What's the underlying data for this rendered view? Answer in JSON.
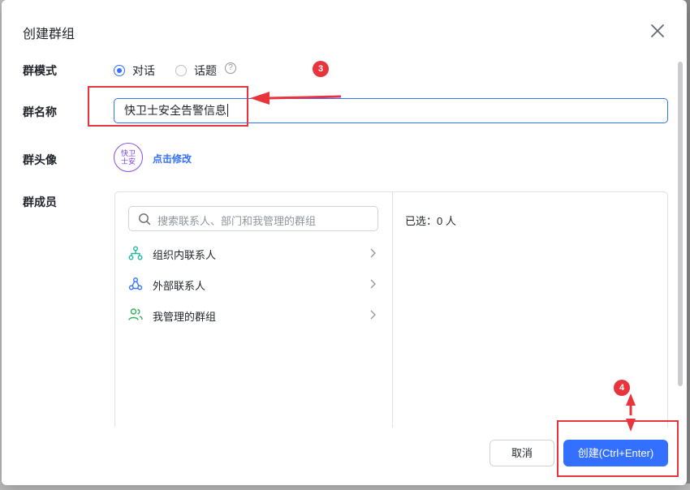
{
  "dialog": {
    "title": "创建群组"
  },
  "form": {
    "mode_label": "群模式",
    "mode_options": [
      "对话",
      "话题"
    ],
    "mode_selected": "对话",
    "mode_help": "?",
    "name_label": "群名称",
    "name_value": "快卫士安全告警信息",
    "avatar_label": "群头像",
    "avatar_text_line1": "快卫",
    "avatar_text_line2": "士安",
    "avatar_edit": "点击修改",
    "members_label": "群成员"
  },
  "members": {
    "search_placeholder": "搜索联系人、部门和我管理的群组",
    "items": [
      {
        "label": "组织内联系人",
        "icon": "org-tree-icon"
      },
      {
        "label": "外部联系人",
        "icon": "external-contacts-icon"
      },
      {
        "label": "我管理的群组",
        "icon": "managed-groups-icon"
      }
    ],
    "selected_text": "已选：0 人"
  },
  "footer": {
    "cancel_label": "取消",
    "create_label": "创建(Ctrl+Enter)"
  },
  "annotations": {
    "step3": "3",
    "step4": "4"
  },
  "colors": {
    "accent": "#3370ff",
    "annotation": "#e8343c",
    "avatar": "#7b3fe4"
  }
}
